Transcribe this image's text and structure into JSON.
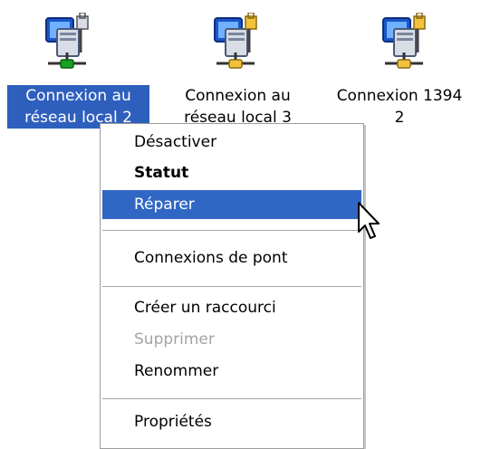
{
  "desktop": {
    "items": [
      {
        "label_line1": "Connexion au",
        "label_line2": "réseau local 2",
        "icon": "network-connection-icon",
        "selected": true
      },
      {
        "label_line1": "Connexion au",
        "label_line2": "réseau local 3",
        "icon": "network-connection-icon",
        "selected": false
      },
      {
        "label_line1": "Connexion 1394",
        "label_line2": "2",
        "icon": "network-connection-icon",
        "selected": false
      }
    ]
  },
  "context_menu": {
    "items": [
      {
        "label": "Désactiver",
        "style": "normal"
      },
      {
        "label": "Statut",
        "style": "bold"
      },
      {
        "label": "Réparer",
        "style": "highlighted"
      },
      {
        "label": "Connexions de pont",
        "style": "normal"
      },
      {
        "label": "Créer un raccourci",
        "style": "normal"
      },
      {
        "label": "Supprimer",
        "style": "disabled"
      },
      {
        "label": "Renommer",
        "style": "normal"
      },
      {
        "label": "Propriétés",
        "style": "normal"
      }
    ]
  },
  "colors": {
    "selection": "#2f5fbd",
    "menu_highlight": "#3167c4",
    "disabled_text": "#a4a4a4"
  },
  "cursor": {
    "icon": "arrow-cursor-icon"
  }
}
